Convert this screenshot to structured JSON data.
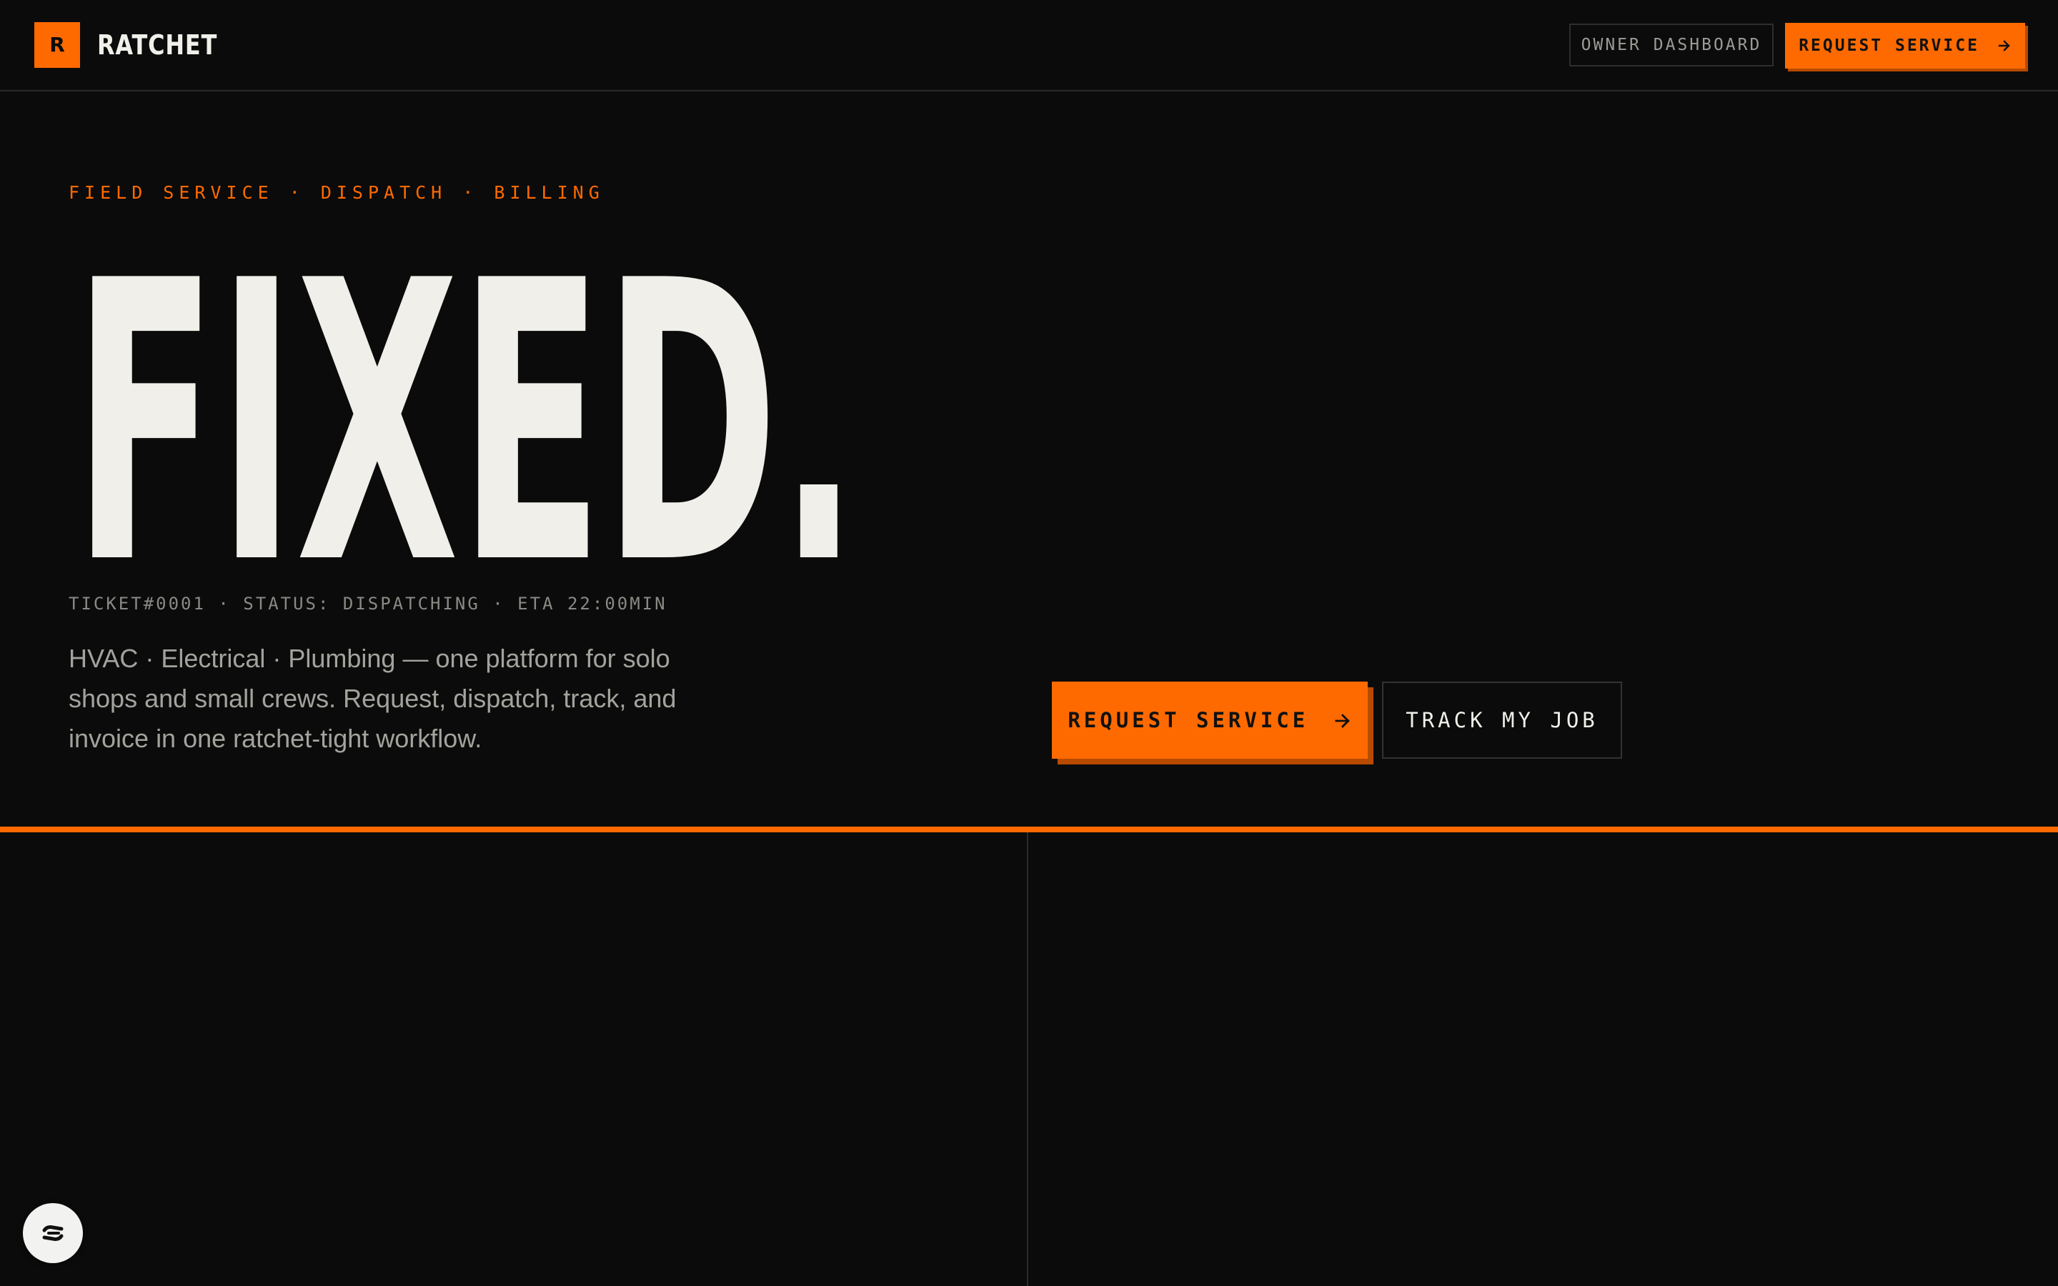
{
  "brand": {
    "logo_letter": "R",
    "name": "RATCHET",
    "accent_color": "#ff6a00",
    "background_color": "#0b0b0b"
  },
  "header": {
    "owner_dashboard_label": "OWNER DASHBOARD",
    "request_service_label": "REQUEST SERVICE",
    "request_service_icon": "arrow-right-icon"
  },
  "hero": {
    "eyebrow": "FIELD SERVICE · DISPATCH · BILLING",
    "headline": "FIXED.",
    "ticket_line": "TICKET#0001 · STATUS: DISPATCHING · ETA 22:00MIN",
    "description": "HVAC · Electrical · Plumbing — one platform for solo shops and small crews. Request, dispatch, track, and invoice in one ratchet-tight workflow.",
    "cta_primary_label": "REQUEST SERVICE",
    "cta_primary_icon": "arrow-right-icon",
    "cta_secondary_label": "TRACK MY JOB"
  },
  "floating_badge": {
    "icon": "wrench-link-icon"
  }
}
